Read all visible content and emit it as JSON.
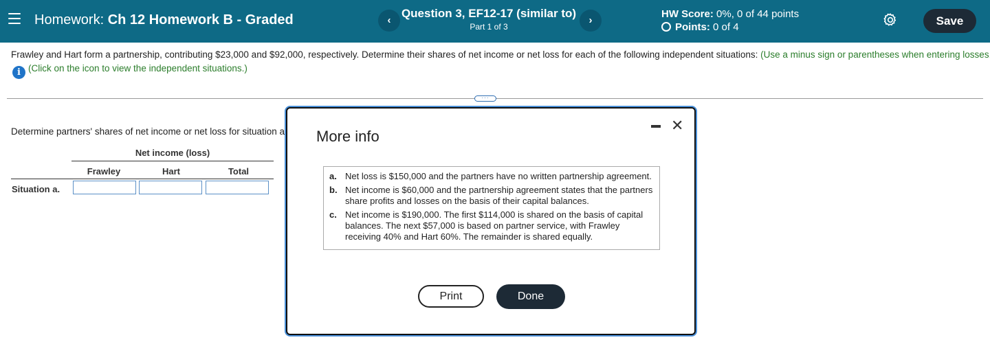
{
  "header": {
    "hw_prefix": "Homework:",
    "hw_name": "Ch 12 Homework B - Graded",
    "question_title": "Question 3, EF12-17 (similar to)",
    "part": "Part 1 of 3",
    "prev_icon": "‹",
    "next_icon": "›",
    "hw_score_label": "HW Score:",
    "hw_score_value": "0%, 0 of 44 points",
    "points_label": "Points:",
    "points_value": "0 of 4",
    "save_label": "Save"
  },
  "problem": {
    "text": "Frawley and Hart form a partnership, contributing $23,000 and $92,000, respectively. Determine their shares of net income or net loss for each of the following independent situations:",
    "hint": "(Use a minus sign or parentheses when entering losses.)",
    "info_link": "(Click on the icon to view the independent situations.)"
  },
  "left_panel": {
    "instruction": "Determine partners' shares of net income or net loss for situation a.",
    "group_header": "Net income (loss)",
    "columns": [
      "Frawley",
      "Hart",
      "Total"
    ],
    "row_label": "Situation a."
  },
  "modal": {
    "title": "More info",
    "items": [
      {
        "letter": "a.",
        "text": "Net loss is $150,000 and the partners have no written partnership agreement."
      },
      {
        "letter": "b.",
        "text": "Net income is $60,000 and the partnership agreement states that the partners share profits and losses on the basis of their capital balances."
      },
      {
        "letter": "c.",
        "text": "Net income is $190,000. The first $114,000 is shared on the basis of capital balances. The next $57,000 is based on partner service, with Frawley receiving 40% and Hart 60%. The remainder is shared equally."
      }
    ],
    "print_label": "Print",
    "done_label": "Done",
    "close_icon": "✕"
  },
  "colors": {
    "header_bg": "#0e6a86",
    "save_bg": "#1d2a36",
    "hint_green": "#2b7d2b",
    "info_blue": "#1f74c8"
  }
}
